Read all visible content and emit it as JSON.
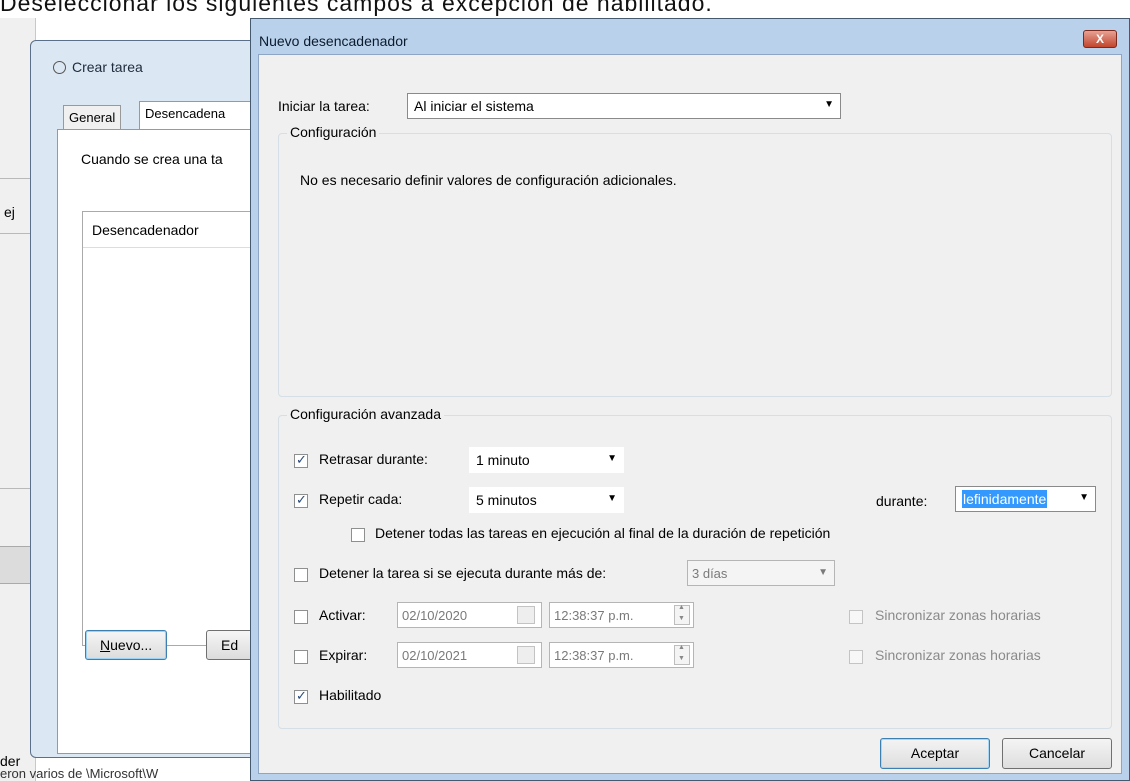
{
  "caption": "Deseleccionar los siguientes campos a excepción de habilitado.",
  "background_app": {
    "ej_text": "ej",
    "der_text": "der",
    "bottom_text": "eron varios de     \\Microsoft\\W"
  },
  "crear_tarea": {
    "title": "Crear tarea",
    "tabs": [
      "General",
      "Desencadena"
    ],
    "description": "Cuando se crea una ta",
    "list_header": "Desencadenador",
    "nuevo_button": "Nuevo...",
    "editar_button": "Ed"
  },
  "dialog": {
    "title": "Nuevo desencadenador",
    "close_label": "X",
    "iniciar_label": "Iniciar la tarea:",
    "iniciar_value": "Al iniciar el sistema",
    "config_legend": "Configuración",
    "config_message": "No es necesario definir valores de configuración adicionales.",
    "advanced_legend": "Configuración avanzada",
    "retrasar": {
      "label": "Retrasar durante:",
      "checked": true,
      "value": "1 minuto"
    },
    "repetir": {
      "label": "Repetir cada:",
      "checked": true,
      "value": "5 minutos",
      "duration_label": "durante:",
      "duration_value": "lefinidamente"
    },
    "detener_todas": {
      "label": "Detener todas las tareas en ejecución al final de la duración de repetición",
      "checked": false
    },
    "detener_tarea": {
      "label": "Detener la tarea si se ejecuta durante más de:",
      "checked": false,
      "value": "3 días"
    },
    "activar": {
      "label": "Activar:",
      "checked": false,
      "date": "02/10/2020",
      "time": "12:38:37 p.m.",
      "sync_label": "Sincronizar zonas horarias"
    },
    "expirar": {
      "label": "Expirar:",
      "checked": false,
      "date": "02/10/2021",
      "time": "12:38:37 p.m.",
      "sync_label": "Sincronizar zonas horarias"
    },
    "habilitado": {
      "label": "Habilitado",
      "checked": true
    },
    "ok_button": "Aceptar",
    "cancel_button": "Cancelar"
  }
}
